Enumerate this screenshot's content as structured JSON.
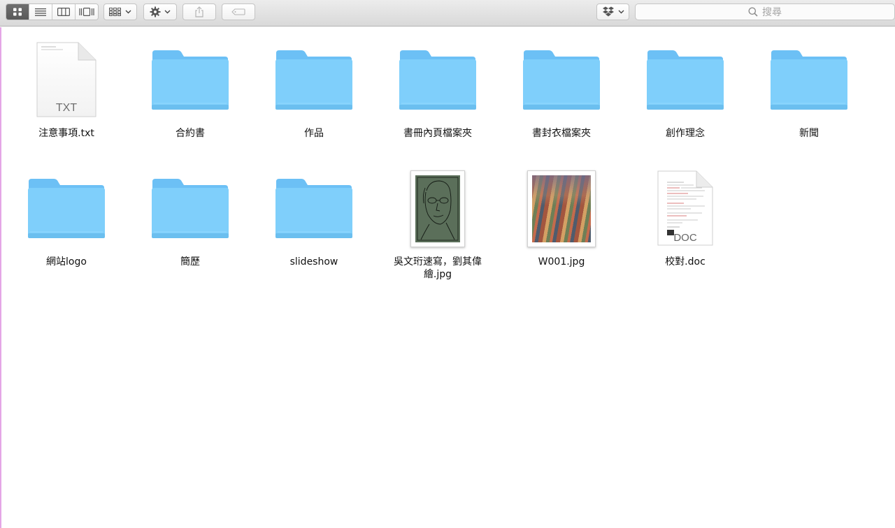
{
  "toolbar": {
    "view_modes": [
      {
        "name": "icon-view",
        "active": true
      },
      {
        "name": "list-view",
        "active": false
      },
      {
        "name": "column-view",
        "active": false
      },
      {
        "name": "cover-flow-view",
        "active": false
      }
    ],
    "arrange_icon": "arrange-grid-icon",
    "action_icon": "gear-icon",
    "share_icon": "share-icon",
    "tag_icon": "tag-icon",
    "dropbox_icon": "dropbox-icon",
    "search_placeholder": "搜尋"
  },
  "files": [
    {
      "name": "注意事項.txt",
      "kind": "txt",
      "badge": "TXT"
    },
    {
      "name": "合約書",
      "kind": "folder"
    },
    {
      "name": "作品",
      "kind": "folder"
    },
    {
      "name": "書冊內頁檔案夾",
      "kind": "folder"
    },
    {
      "name": "書封衣檔案夾",
      "kind": "folder"
    },
    {
      "name": "創作理念",
      "kind": "folder"
    },
    {
      "name": "新聞",
      "kind": "folder"
    },
    {
      "name": "網站logo",
      "kind": "folder"
    },
    {
      "name": "簡歷",
      "kind": "folder"
    },
    {
      "name": "slideshow",
      "kind": "folder"
    },
    {
      "name": "吳文珩速寫，劉其偉繪.jpg",
      "kind": "image-sketch"
    },
    {
      "name": "W001.jpg",
      "kind": "image-painting"
    },
    {
      "name": "校對.doc",
      "kind": "doc",
      "badge": "DOC"
    }
  ],
  "colors": {
    "folder_body": "#7fcffb",
    "folder_tab": "#6cc0f5",
    "active_segment": "#626262"
  }
}
